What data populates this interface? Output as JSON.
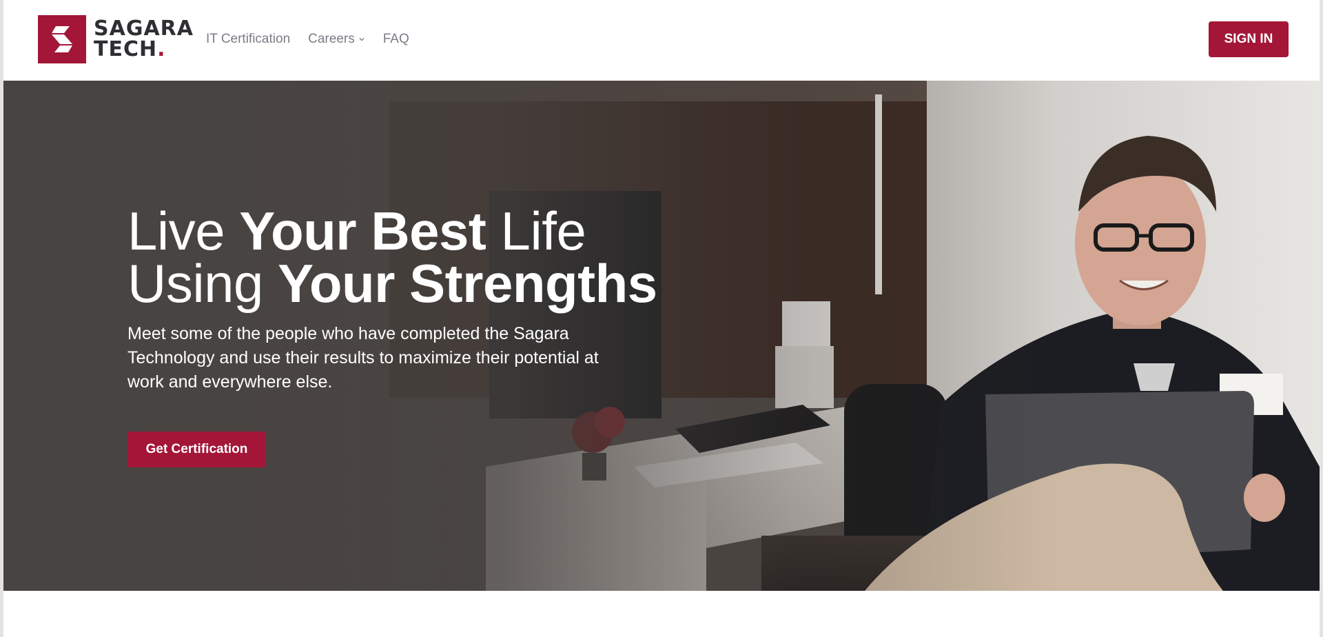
{
  "brand": {
    "name_line1": "SAGARA",
    "name_line2": "TECH",
    "name_dot": ".",
    "brand_color": "#a31638",
    "logo_icon": "sagara-s-logo-icon"
  },
  "nav": {
    "items": [
      {
        "label": "IT Certification",
        "has_dropdown": false
      },
      {
        "label": "Careers",
        "has_dropdown": true,
        "icon": "chevron-down-icon"
      },
      {
        "label": "FAQ",
        "has_dropdown": false
      }
    ],
    "signin_label": "SIGN IN"
  },
  "hero": {
    "title_line1_normal": "Live ",
    "title_line1_bold": "Your Best",
    "title_line1_tail": " Life",
    "title_line2_normal": "Using ",
    "title_line2_bold": "Your Strengths",
    "subtitle": "Meet some of the people who have completed the Sagara Technology and use their results to maximize their potential at work and everywhere else.",
    "cta_label": "Get Certification"
  },
  "colors": {
    "accent": "#a31638",
    "nav_text": "#7a7d85",
    "logo_text": "#2e2e33"
  }
}
